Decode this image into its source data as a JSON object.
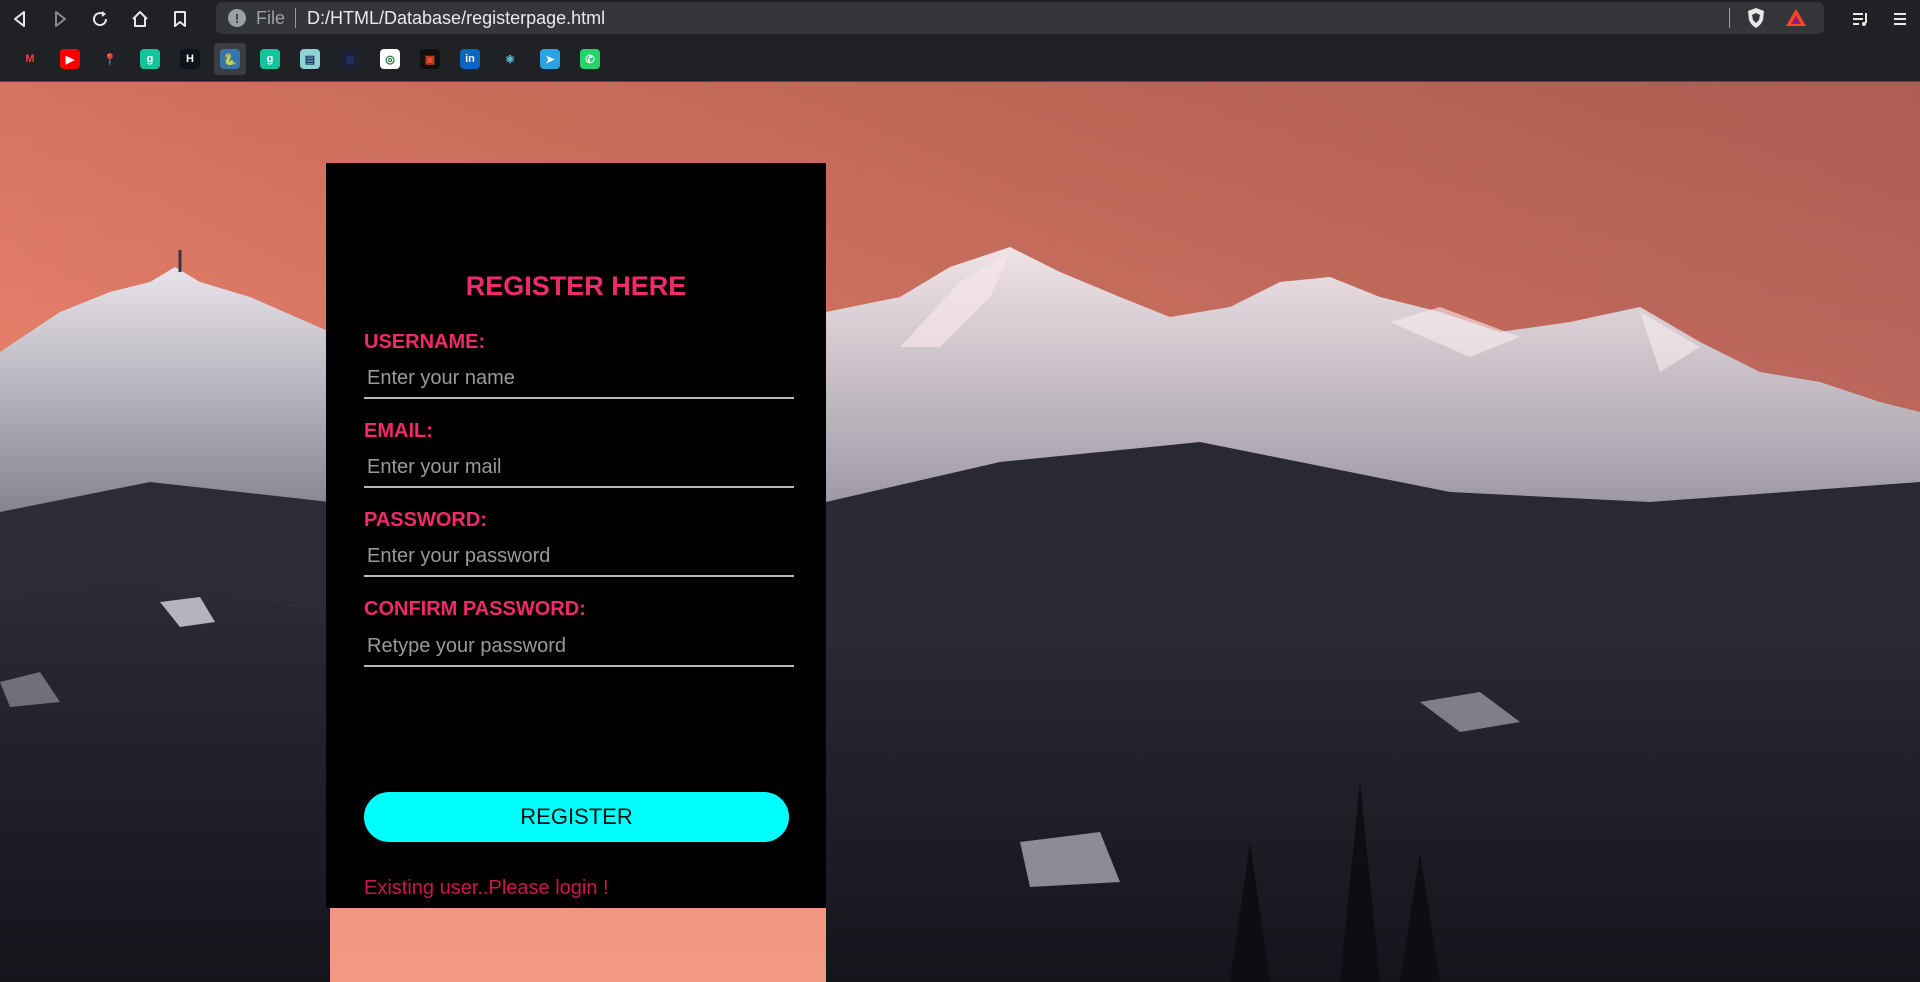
{
  "browser": {
    "url_scheme": "File",
    "url": "D:/HTML/Database/registerpage.html",
    "bookmarks": [
      {
        "name": "gmail",
        "glyph": "M",
        "color": "#ea4335",
        "bg": "#202124"
      },
      {
        "name": "youtube",
        "glyph": "▶",
        "color": "#ffffff",
        "bg": "#ff0000"
      },
      {
        "name": "maps",
        "glyph": "📍",
        "color": "#34a853",
        "bg": "#202124"
      },
      {
        "name": "grammarly",
        "glyph": "g",
        "color": "#ffffff",
        "bg": "#15c39a"
      },
      {
        "name": "hackerrank",
        "glyph": "H",
        "color": "#ffffff",
        "bg": "#0e141e"
      },
      {
        "name": "python",
        "glyph": "🐍",
        "color": "#f7d548",
        "bg": "#3776ab"
      },
      {
        "name": "grammarly-2",
        "glyph": "g",
        "color": "#ffffff",
        "bg": "#15c39a"
      },
      {
        "name": "notebook",
        "glyph": "▤",
        "color": "#1f3a60",
        "bg": "#8fd3d8"
      },
      {
        "name": "dark-site",
        "glyph": "◼",
        "color": "#22305a",
        "bg": "#1b2238"
      },
      {
        "name": "open-source",
        "glyph": "◎",
        "color": "#1a6b3c",
        "bg": "#ffffff"
      },
      {
        "name": "code-site",
        "glyph": "▣",
        "color": "#e84a27",
        "bg": "#111111"
      },
      {
        "name": "linkedin",
        "glyph": "in",
        "color": "#ffffff",
        "bg": "#0a66c2"
      },
      {
        "name": "react",
        "glyph": "⚛",
        "color": "#61dafb",
        "bg": "#202124"
      },
      {
        "name": "telegram",
        "glyph": "➤",
        "color": "#ffffff",
        "bg": "#2aa3e0"
      },
      {
        "name": "whatsapp",
        "glyph": "✆",
        "color": "#ffffff",
        "bg": "#25d366"
      }
    ]
  },
  "form": {
    "title": "REGISTER HERE",
    "username_label": "USERNAME:",
    "username_placeholder": "Enter your name",
    "email_label": "EMAIL:",
    "email_placeholder": "Enter your mail",
    "password_label": "PASSWORD:",
    "password_placeholder": "Enter your password",
    "confirm_label": "CONFIRM PASSWORD:",
    "confirm_placeholder": "Retype your password",
    "register_label": "REGISTER",
    "login_link": "Existing user..Please login !"
  },
  "colors": {
    "accent": "#f22a6c",
    "button": "#00ffff",
    "card": "#000000",
    "sky_top": "#d87a68",
    "sky_bottom": "#f08874"
  }
}
